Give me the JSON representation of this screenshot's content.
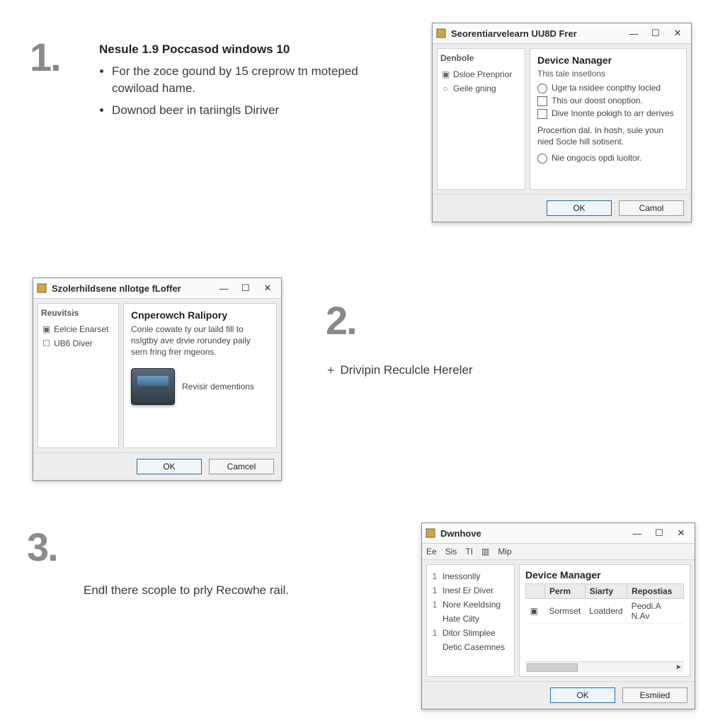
{
  "steps": {
    "one": {
      "number": "1.",
      "title": "Nesule 1.9 Poccasod windows 10",
      "bullets": [
        "For the zoce gound by 15 creprow tn moteped cowiload hame.",
        "Downod beer in tariingls Diriver"
      ]
    },
    "two": {
      "number": "2.",
      "line_prefix": "+",
      "line": "Drivipin Reculcle Hereler"
    },
    "three": {
      "number": "3.",
      "line": "Endl there scople to prly Recowhe rail."
    }
  },
  "dialog1": {
    "title": "Seorentiarvelearn UU8D Frer",
    "win_buttons": [
      "—",
      "☐",
      "✕"
    ],
    "sidebar": {
      "header": "Denbole",
      "items": [
        {
          "icon": "▣",
          "label": "Dsloe Prenprior"
        },
        {
          "icon": "○",
          "label": "Geile gning"
        }
      ]
    },
    "content": {
      "heading": "Device Nanager",
      "subheading": "This tale insetlons",
      "options": [
        {
          "type": "radio",
          "label": "Uge ta nsidee conpthy locled"
        },
        {
          "type": "check",
          "label": "This our doost onoption."
        },
        {
          "type": "check",
          "label": "Dive Inonte pokigh to arr derives"
        }
      ],
      "paragraph": "Procertion dal. In hosh, sule youn nied Socle hill sotisent.",
      "last": {
        "type": "radio",
        "label": "Nie ongocis opdi luoltor."
      }
    },
    "buttons": {
      "ok": "OK",
      "cancel": "Camol"
    }
  },
  "dialog2": {
    "title": "Szolerhildsene nllotge fLoffer",
    "win_buttons": [
      "—",
      "☐",
      "✕"
    ],
    "sidebar": {
      "header": "Reuvitsis",
      "items": [
        {
          "icon": "▣",
          "label": "Eelcie Enarset"
        },
        {
          "icon": "☐",
          "label": "UB6 Diver"
        }
      ]
    },
    "content": {
      "heading": "Cnperowch Ralipory",
      "paragraph": "Conle cowate ty our laild fill to nslgtby ave drvie rorundey paily sern fring frer mgeons.",
      "device_label": "Revisir dementions"
    },
    "buttons": {
      "ok": "OK",
      "cancel": "Camcel"
    }
  },
  "dialog3": {
    "title": "Dwnhove",
    "win_buttons": [
      "—",
      "☐",
      "✕"
    ],
    "menu": [
      "Ее",
      "Sis",
      "TI",
      "▥",
      "Mip"
    ],
    "sidebar": {
      "items": [
        {
          "n": "1",
          "label": "Inessonlly"
        },
        {
          "n": "1",
          "label": "Inesl Er Diver"
        },
        {
          "n": "1",
          "label": "Nore Keeldsing"
        },
        {
          "n": "",
          "label": "Hate Cilty"
        },
        {
          "n": "1",
          "label": "Ditor Slimplee"
        },
        {
          "n": "",
          "label": "Detic Casemnes"
        }
      ]
    },
    "content": {
      "heading": "Device Manager",
      "columns": [
        "Perm",
        "Siarty",
        "Repostias"
      ],
      "rows": [
        {
          "icon": "▣",
          "c0": "Sormset",
          "c1": "Loatderd",
          "c2": "Peodi.A N.Av"
        }
      ]
    },
    "buttons": {
      "ok": "OK",
      "cancel": "Esmiied"
    }
  }
}
